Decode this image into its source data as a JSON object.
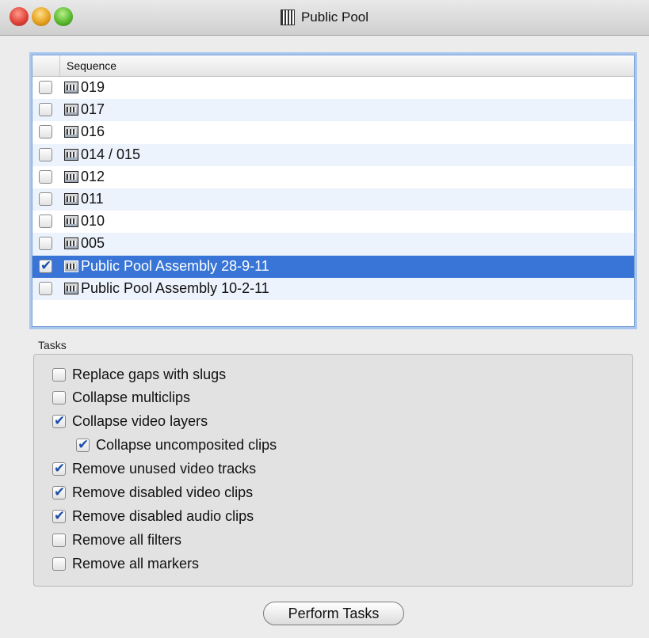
{
  "window": {
    "title": "Public Pool"
  },
  "sequence_list": {
    "column_header": "Sequence",
    "rows": [
      {
        "label": "019",
        "checked": false,
        "selected": false
      },
      {
        "label": "017",
        "checked": false,
        "selected": false
      },
      {
        "label": "016",
        "checked": false,
        "selected": false
      },
      {
        "label": "014 / 015",
        "checked": false,
        "selected": false
      },
      {
        "label": "012",
        "checked": false,
        "selected": false
      },
      {
        "label": "011",
        "checked": false,
        "selected": false
      },
      {
        "label": "010",
        "checked": false,
        "selected": false
      },
      {
        "label": "005",
        "checked": false,
        "selected": false
      },
      {
        "label": "Public Pool Assembly 28-9-11",
        "checked": true,
        "selected": true
      },
      {
        "label": "Public Pool Assembly 10-2-11",
        "checked": false,
        "selected": false
      }
    ]
  },
  "tasks": {
    "label": "Tasks",
    "items": [
      {
        "label": "Replace gaps with slugs",
        "checked": false,
        "indent": false
      },
      {
        "label": "Collapse multiclips",
        "checked": false,
        "indent": false
      },
      {
        "label": "Collapse video layers",
        "checked": true,
        "indent": false
      },
      {
        "label": "Collapse uncomposited clips",
        "checked": true,
        "indent": true
      },
      {
        "label": "Remove unused video tracks",
        "checked": true,
        "indent": false
      },
      {
        "label": "Remove disabled video clips",
        "checked": true,
        "indent": false
      },
      {
        "label": "Remove disabled audio clips",
        "checked": true,
        "indent": false
      },
      {
        "label": "Remove all filters",
        "checked": false,
        "indent": false
      },
      {
        "label": "Remove all markers",
        "checked": false,
        "indent": false
      }
    ]
  },
  "perform_button": {
    "label": "Perform Tasks"
  },
  "colors": {
    "selection": "#3875d7",
    "alt_row": "#edf3fd",
    "focus_ring": "#a9c7ee"
  }
}
